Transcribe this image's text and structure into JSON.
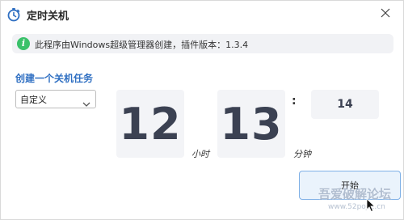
{
  "window": {
    "title": "定时关机",
    "title_icon": "stopwatch-icon",
    "close_icon": "close-icon"
  },
  "info": {
    "icon": "info-icon",
    "icon_glyph": "i",
    "text": "此程序由Windows超级管理器创建，插件版本：1.3.4"
  },
  "task": {
    "section_title": "创建一个关机任务",
    "mode_select": {
      "value": "自定义",
      "icon": "chevron-down-icon"
    }
  },
  "time": {
    "hours": "12",
    "hours_unit": "小时",
    "minutes": "13",
    "minutes_unit": "分钟",
    "separator": ":",
    "seconds": "14"
  },
  "actions": {
    "start_label": "开始"
  },
  "watermark": {
    "text": "吾爱破解论坛",
    "url": "www.52pojie.cn"
  },
  "colors": {
    "accent": "#2f6fc2",
    "info_green": "#3ac16a",
    "tile_bg": "#f3f4f7",
    "digit": "#3b4152"
  }
}
